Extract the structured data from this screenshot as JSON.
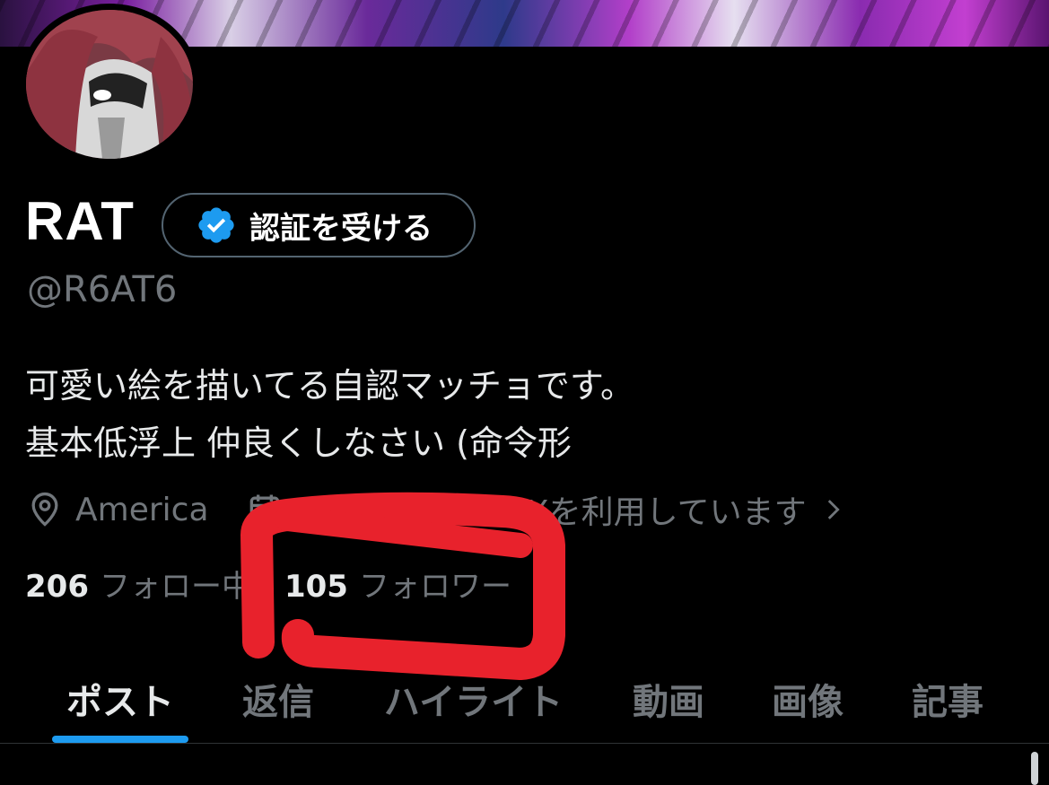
{
  "profile": {
    "display_name": "RAT",
    "handle": "@R6AT6",
    "verify_button_label": "認証を受ける",
    "bio_lines": [
      "可愛い絵を描いてる自認マッチョです。",
      "基本低浮上 仲良くしなさい (命令形"
    ],
    "location": "America",
    "joined": "2025年5月からXを利用しています",
    "following_count": "206",
    "following_label": "フォロー中",
    "followers_count": "105",
    "followers_label": "フォロワー"
  },
  "tabs": [
    "ポスト",
    "返信",
    "ハイライト",
    "動画",
    "画像",
    "記事"
  ],
  "active_tab": "ポスト",
  "colors": {
    "accent": "#1d9bf0",
    "muted": "#71767b",
    "annotation_red": "#e8222c"
  },
  "icons": [
    "location-pin-icon",
    "calendar-icon",
    "chevron-right-icon",
    "verified-badge-icon"
  ]
}
